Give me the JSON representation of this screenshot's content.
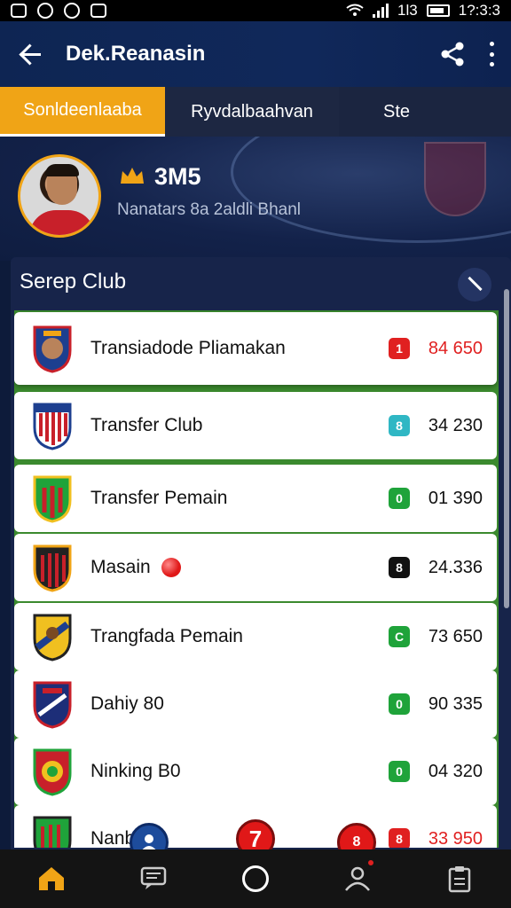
{
  "status_bar": {
    "left_icons": [
      "app-icon-b",
      "app-icon-circle",
      "app-icon-clock",
      "app-icon-square"
    ],
    "battery_label": "1l3",
    "time": "1?:3:3"
  },
  "app_bar": {
    "title": "Dek.Reanasin"
  },
  "tabs": [
    {
      "label": "Sonldeenlaaba",
      "active": true
    },
    {
      "label": "Ryvdalbaahvan",
      "active": false
    },
    {
      "label": "Ste",
      "active": false
    }
  ],
  "profile": {
    "score": "3M5",
    "subtitle": "Nanatars 8a 2aldli Bhanl"
  },
  "panel": {
    "title": "Serep Club"
  },
  "rows": [
    {
      "label": "Transiadode Pliamakan",
      "badge_text": "1",
      "badge_color": "#e02020",
      "value": "84 650",
      "value_red": true
    },
    {
      "label": "Transfer Club",
      "badge_text": "8",
      "badge_color": "#2fb7c4",
      "value": "34 230",
      "value_red": false
    },
    {
      "label": "Transfer Pemain",
      "badge_text": "0",
      "badge_color": "#1fa33a",
      "value": "01 390",
      "value_red": false
    },
    {
      "label": "Masain",
      "badge_text": "8",
      "badge_color": "#111111",
      "value": "24.336",
      "value_red": false
    },
    {
      "label": "Trangfada Pemain",
      "badge_text": "C",
      "badge_color": "#1fa33a",
      "value": "73 650",
      "value_red": false
    },
    {
      "label": "Dahiy 80",
      "badge_text": "0",
      "badge_color": "#1fa33a",
      "value": "90 335",
      "value_red": false
    },
    {
      "label": "Ninking B0",
      "badge_text": "0",
      "badge_color": "#1fa33a",
      "value": "04 320",
      "value_red": false
    },
    {
      "label": "Nanb8lo",
      "badge_text": "8",
      "badge_color": "#e02020",
      "value": "33 950",
      "value_red": true
    }
  ],
  "fabs": {
    "red_center_label": "7",
    "red_right_label": "8"
  },
  "colors": {
    "accent": "#f0a416",
    "app_bar": "#0e2553",
    "danger": "#e02020",
    "success": "#1fa33a"
  },
  "bottom_nav": [
    "home-icon",
    "chat-icon",
    "circle-icon",
    "person-icon",
    "clipboard-icon"
  ]
}
